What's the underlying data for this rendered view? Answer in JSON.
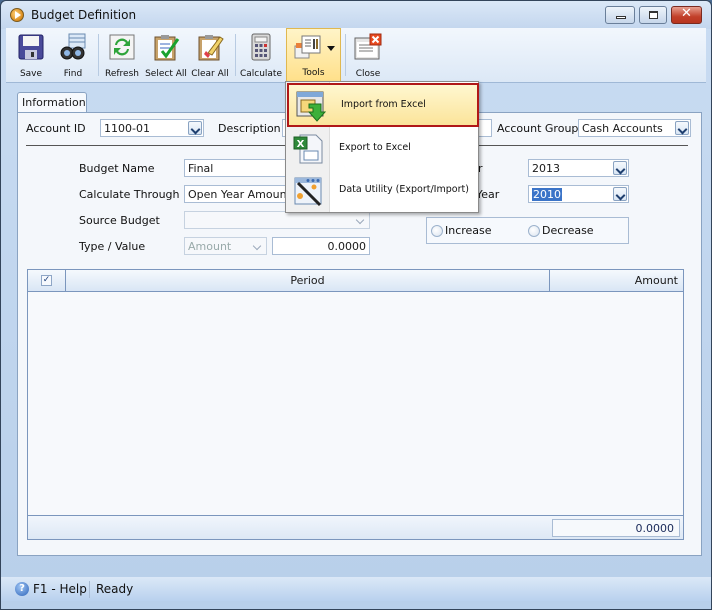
{
  "window": {
    "title": "Budget Definition"
  },
  "toolbar": {
    "buttons": [
      {
        "label": "Save",
        "icon": "floppy-disk-icon"
      },
      {
        "label": "Find",
        "icon": "binoculars-icon"
      },
      {
        "label": "Refresh",
        "icon": "refresh-icon"
      },
      {
        "label": "Select All",
        "icon": "select-all-clipboard-icon"
      },
      {
        "label": "Clear All",
        "icon": "clear-all-clipboard-icon"
      },
      {
        "label": "Calculate",
        "icon": "calculator-icon"
      },
      {
        "label": "Tools",
        "icon": "tools-icon"
      },
      {
        "label": "Close",
        "icon": "close-window-icon"
      }
    ]
  },
  "tools_menu": {
    "items": [
      {
        "label": "Import from Excel",
        "icon": "import-excel-icon",
        "highlighted": true
      },
      {
        "label": "Export to Excel",
        "icon": "export-excel-icon",
        "highlighted": false
      },
      {
        "label": "Data Utility (Export/Import)",
        "icon": "data-utility-icon",
        "highlighted": false
      }
    ]
  },
  "tabs": [
    {
      "label": "Information",
      "active": true
    }
  ],
  "form": {
    "account_id_label": "Account ID",
    "account_id_value": "1100-01",
    "description_label": "Description",
    "description_value": "",
    "account_group_label": "Account Group",
    "account_group_value": "Cash Accounts",
    "budget_name_label": "Budget Name",
    "budget_name_value": "Final",
    "calculate_through_label": "Calculate Through",
    "calculate_through_value": "Open Year Amount",
    "source_budget_label": "Source Budget",
    "source_budget_value": "",
    "type_value_label": "Type / Value",
    "type_value": "Amount",
    "value_amount": "0.0000",
    "year_label_partial": "r",
    "year_value": "2013",
    "source_year_label_partial": "Year",
    "source_year_value": "2010",
    "increase_label": "Increase",
    "decrease_label": "Decrease"
  },
  "grid": {
    "columns": [
      "Period",
      "Amount"
    ],
    "select_all_checked": true,
    "rows": [],
    "total_amount": "0.0000"
  },
  "statusbar": {
    "help": "F1 - Help",
    "status": "Ready"
  }
}
